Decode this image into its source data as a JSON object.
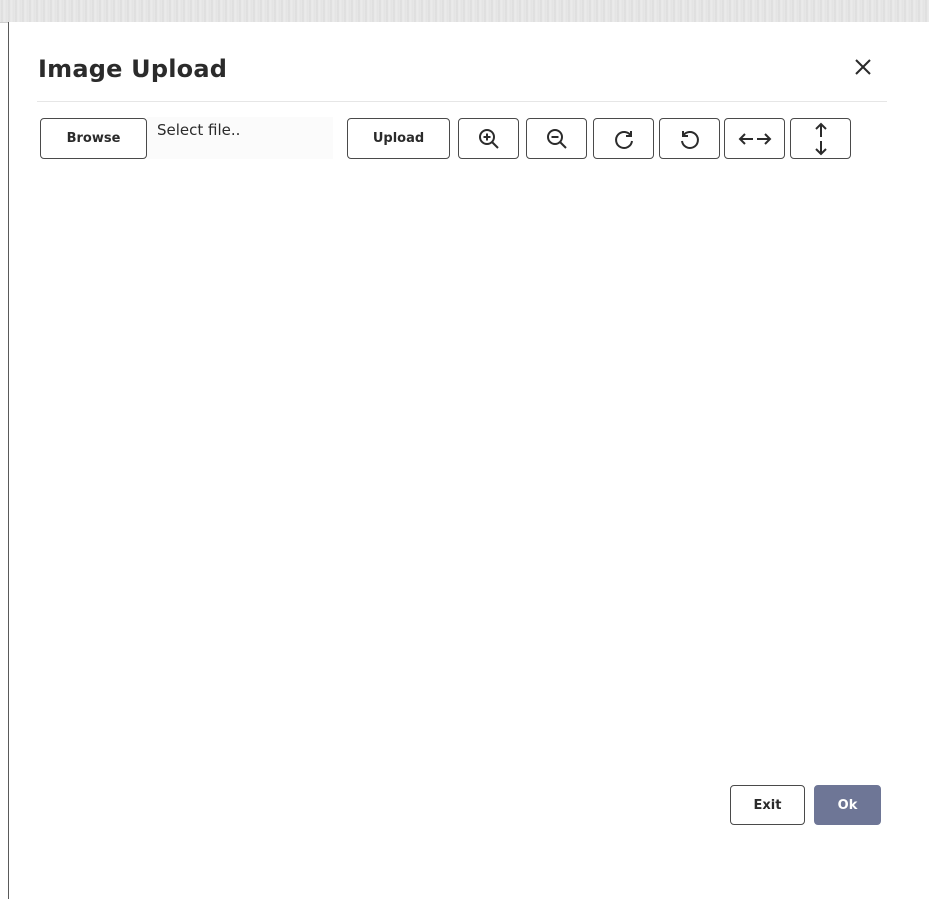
{
  "dialog": {
    "title": "Image Upload",
    "close_icon": "close-icon"
  },
  "toolbar": {
    "browse_label": "Browse",
    "file_value": "Select file..",
    "upload_label": "Upload",
    "icons": [
      "zoom-in-icon",
      "zoom-out-icon",
      "rotate-clockwise-icon",
      "rotate-counterclockwise-icon",
      "flip-horizontal-icon",
      "flip-vertical-icon"
    ]
  },
  "footer": {
    "exit_label": "Exit",
    "ok_label": "Ok"
  },
  "colors": {
    "primary_button": "#6e7696",
    "border": "#4a4a4a",
    "title_text": "#2b2b2b"
  }
}
